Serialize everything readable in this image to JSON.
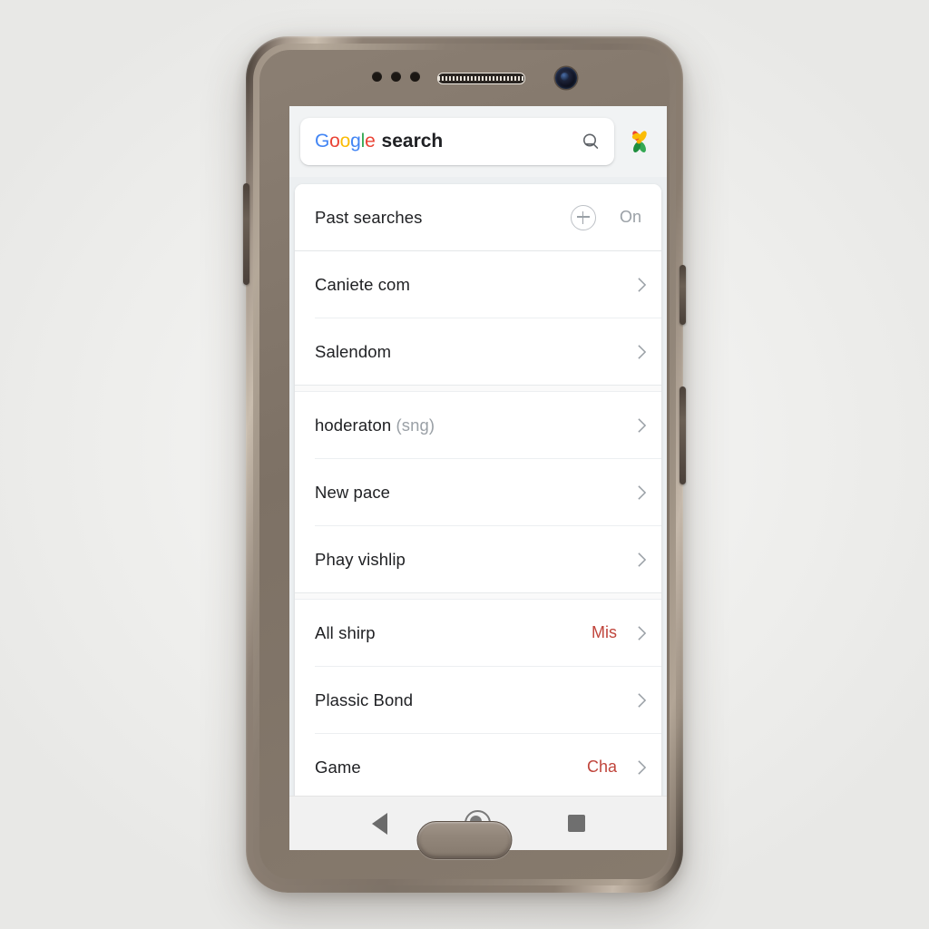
{
  "device": {
    "type": "android-phone",
    "hardware": {
      "sensor_dots": 3,
      "earpiece": "earpiece-speaker",
      "front_camera": "front-camera",
      "home_button": "home-button"
    }
  },
  "screen": {
    "search_header": {
      "logo_letters": [
        "G",
        "o",
        "o",
        "g",
        "l",
        "e"
      ],
      "logo_colors": [
        "#4285F4",
        "#EA4335",
        "#FBBC05",
        "#4285F4",
        "#34A853",
        "#EA4335"
      ],
      "search_word": "search",
      "lens_icon": "lens-search-icon",
      "apps_icon": "google-apps-pinwheel-icon"
    },
    "list": {
      "groups": [
        {
          "rows": [
            {
              "label": "Past searches",
              "value": "On",
              "control": "plus-circle-icon",
              "chevron": false,
              "accent": false
            }
          ]
        },
        {
          "rows": [
            {
              "label": "Caniete com",
              "value": "",
              "chevron": true,
              "accent": false
            },
            {
              "label": "Salendom",
              "value": "",
              "chevron": true,
              "accent": false
            }
          ]
        },
        {
          "rows": [
            {
              "label": "hoderaton",
              "label_muted": "(sng)",
              "value": "",
              "chevron": true,
              "accent": false
            },
            {
              "label": "New pace",
              "value": "",
              "chevron": true,
              "accent": false
            },
            {
              "label": "Phay vishlip",
              "value": "",
              "chevron": true,
              "accent": false
            }
          ]
        },
        {
          "rows": [
            {
              "label": "All shirp",
              "value": "Mis",
              "chevron": true,
              "accent": true
            },
            {
              "label": "Plassic Bond",
              "value": "",
              "chevron": true,
              "accent": false
            },
            {
              "label": "Game",
              "value": "Cha",
              "chevron": true,
              "accent": true
            }
          ]
        }
      ]
    },
    "navbar": {
      "back": "back-nav-button",
      "home": "home-nav-button",
      "recents": "recents-nav-button"
    }
  },
  "colors": {
    "accent_red": "#c0453c",
    "muted_text": "#9aa0a6",
    "primary_text": "#202124",
    "header_bg": "#f1f3f4",
    "card_bg": "#ffffff",
    "navbar_bg": "#f1f1f1"
  }
}
